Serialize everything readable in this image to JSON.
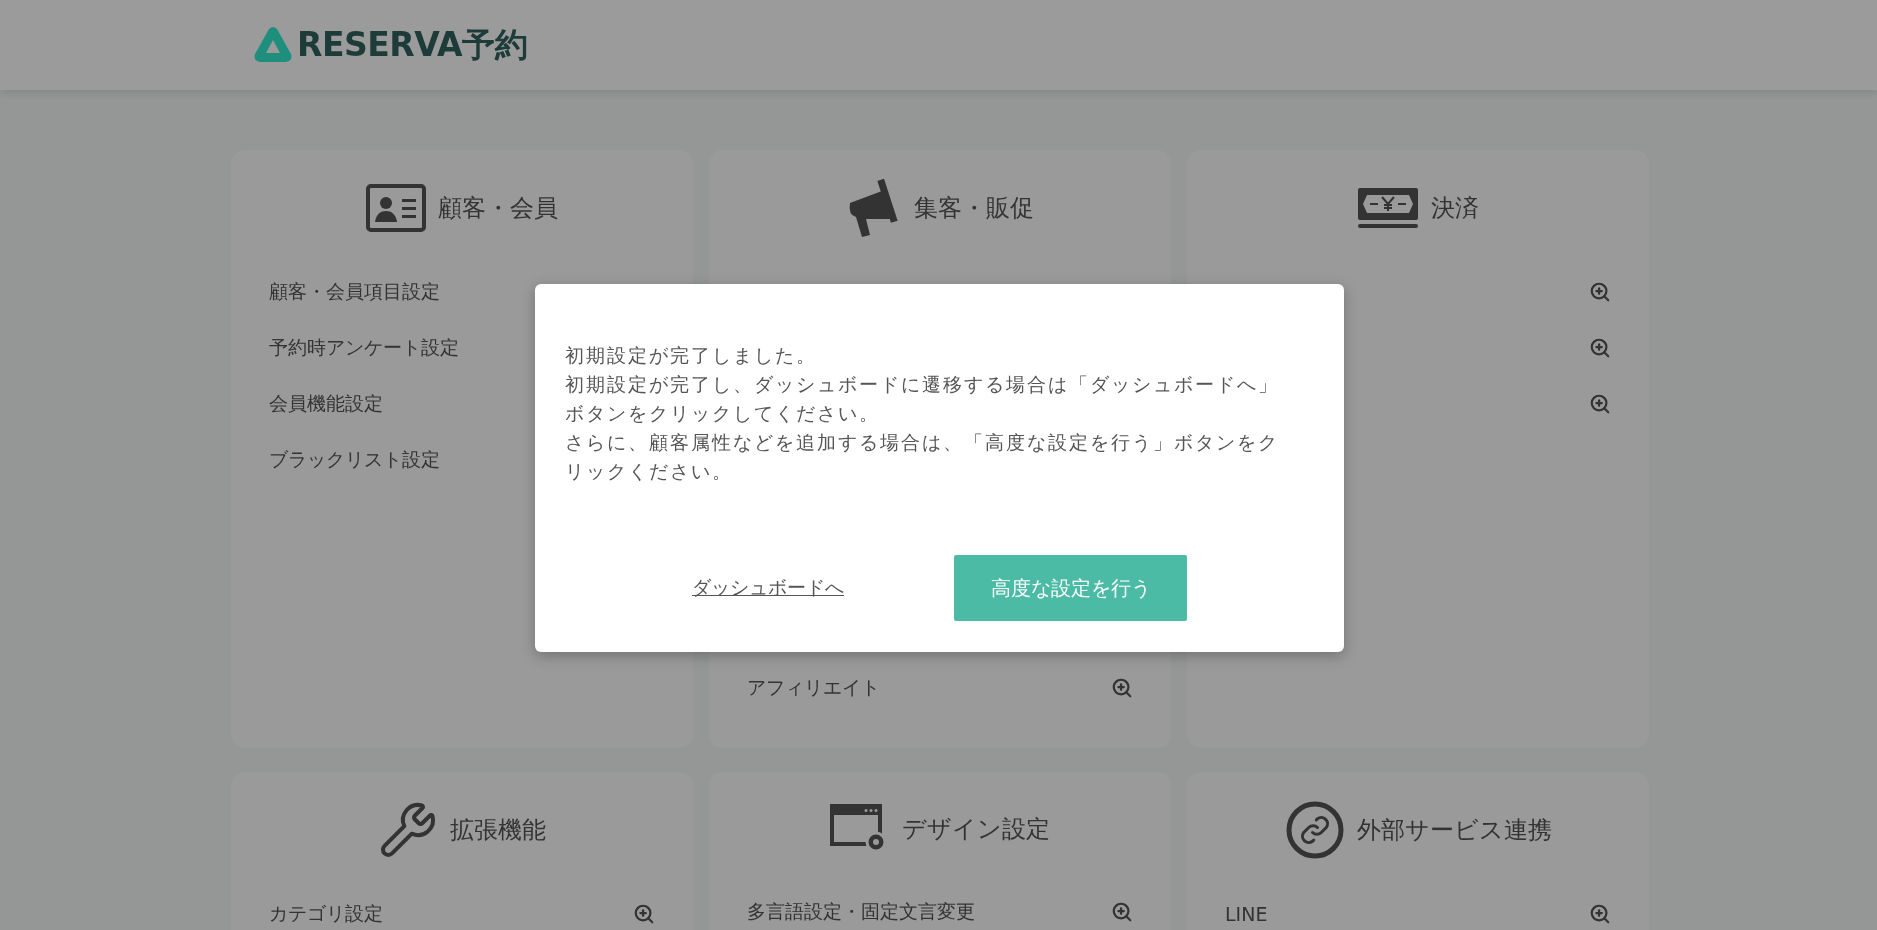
{
  "header": {
    "logo": "RESERVA予約"
  },
  "cards": [
    {
      "kind": "customers",
      "title": "顧客・会員",
      "items": [
        {
          "kind": "text",
          "label": "顧客・会員項目設定"
        },
        {
          "kind": "text",
          "label": "予約時アンケート設定"
        },
        {
          "kind": "text",
          "label": "会員機能設定"
        },
        {
          "kind": "text",
          "label": "ブラックリスト設定"
        }
      ]
    },
    {
      "kind": "promotion",
      "title": "集客・販促",
      "items": [
        {
          "kind": "link",
          "label": "アフィリエイト"
        }
      ]
    },
    {
      "kind": "payment",
      "title": "決済",
      "items": [
        {
          "kind": "icon"
        },
        {
          "kind": "icon"
        },
        {
          "kind": "icon"
        }
      ]
    },
    {
      "kind": "extensions",
      "title": "拡張機能",
      "items": [
        {
          "kind": "link",
          "label": "カテゴリ設定"
        }
      ]
    },
    {
      "kind": "design",
      "title": "デザイン設定",
      "items": [
        {
          "kind": "link",
          "label": "多言語設定・固定文言変更"
        }
      ]
    },
    {
      "kind": "integrations",
      "title": "外部サービス連携",
      "items": [
        {
          "kind": "link",
          "label": "LINE"
        }
      ]
    }
  ],
  "modal": {
    "lines": [
      "初期設定が完了しました。",
      "初期設定が完了し、ダッシュボードに遷移する場合は「ダッシュボードへ」ボタンをクリックしてください。",
      "さらに、顧客属性などを追加する場合は、「高度な設定を行う」ボタンをクリックください。"
    ],
    "link": "ダッシュボードへ",
    "button": "高度な設定を行う"
  }
}
